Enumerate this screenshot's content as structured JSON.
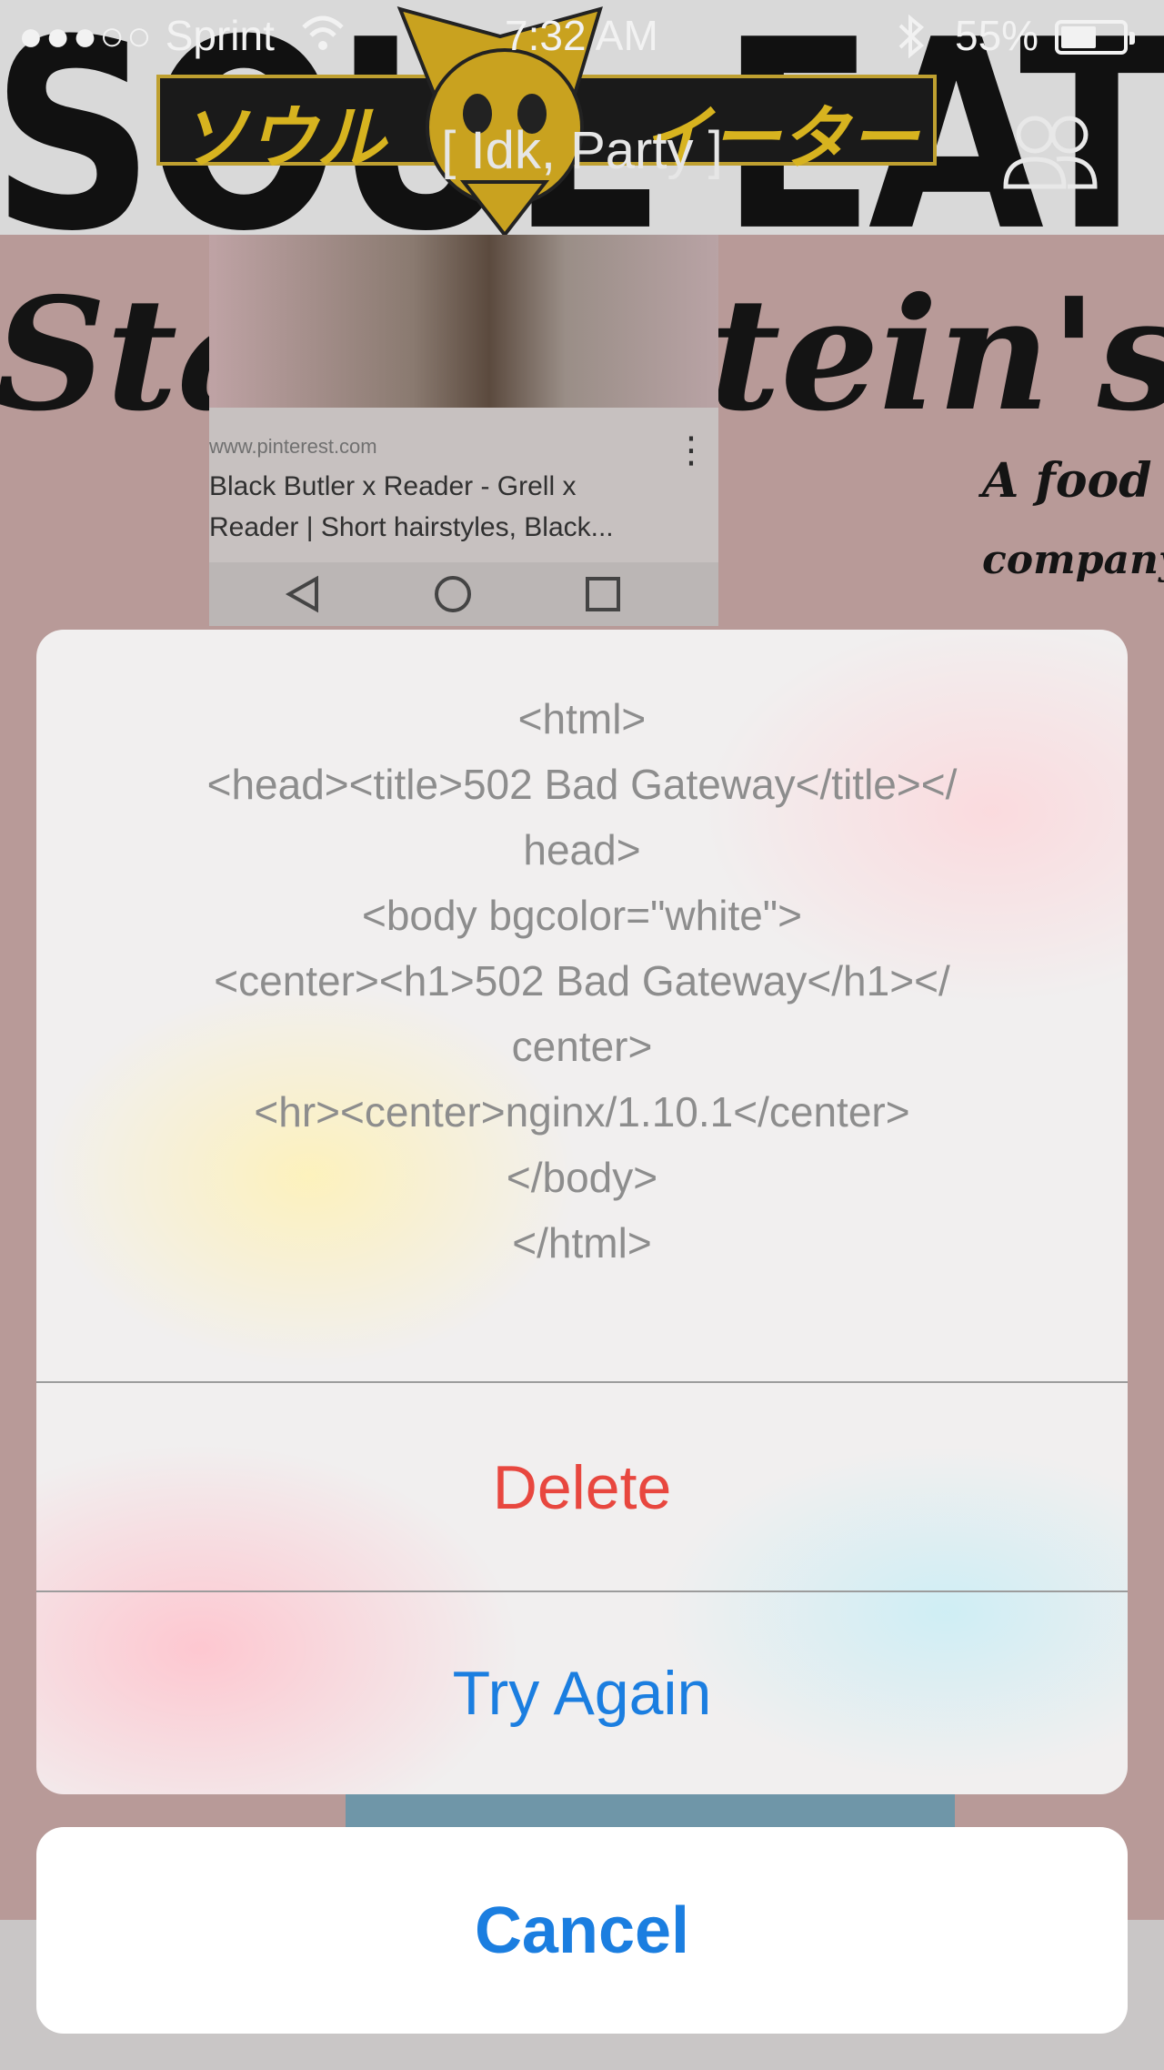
{
  "status_bar": {
    "carrier": "Sprint",
    "time": "7:32 AM",
    "battery_pct": "55%"
  },
  "header": {
    "backdrop_text": "SOUL EATER",
    "logo_katakana_left": "ソウル",
    "logo_katakana_right": "イーター",
    "group_title": "[ Idk, Party ]"
  },
  "background_post": {
    "heading_left": "Sta",
    "heading_right": "tein's",
    "tagline_1": "A food",
    "tagline_2": "company",
    "pin_url": "www.pinterest.com",
    "pin_title": "Black Butler x Reader - Grell x Reader | Short hairstyles, Black..."
  },
  "action_sheet": {
    "message_lines": [
      "<html>",
      "<head><title>502 Bad Gateway</title></",
      "head>",
      "<body bgcolor=\"white\">",
      "<center><h1>502 Bad Gateway</h1></",
      "center>",
      "<hr><center>nginx/1.10.1</center>",
      "</body>",
      "</html>"
    ],
    "delete_label": "Delete",
    "try_again_label": "Try Again",
    "cancel_label": "Cancel"
  },
  "colors": {
    "destructive": "#e8473f",
    "action": "#1b7ee0",
    "message_text": "#8d8d8d"
  }
}
